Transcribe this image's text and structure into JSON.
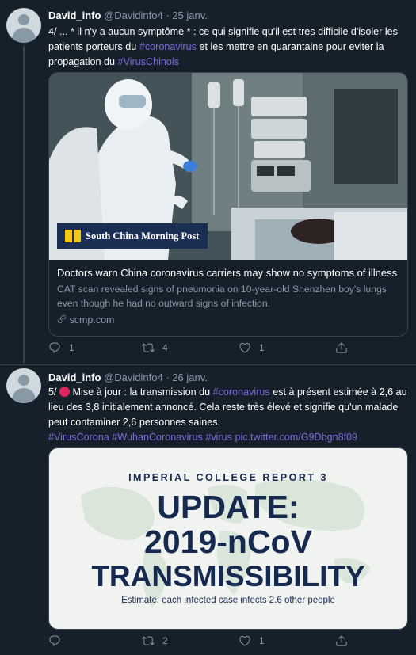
{
  "tweets": [
    {
      "author": "David_info",
      "handle": "@Davidinfo4",
      "date": "· 25 janv.",
      "text": {
        "t1": "4/ ... * il n'y a aucun symptôme * : ce qui signifie qu'il est tres difficile d'isoler les patients porteurs du ",
        "h1": "#coronavirus",
        "t2": " et les mettre en quarantaine pour eviter la propagation du ",
        "h2": "#VirusChinois"
      },
      "card": {
        "logo_text": "South China Morning Post",
        "title": "Doctors warn China coronavirus carriers may show no symptoms of illness",
        "description": "CAT scan revealed signs of pneumonia on 10-year-old Shenzhen boy's lungs even though he had no outward signs of infection.",
        "domain": "scmp.com"
      },
      "actions": {
        "replies": "1",
        "retweets": "4",
        "likes": "1"
      }
    },
    {
      "author": "David_info",
      "handle": "@Davidinfo4",
      "date": "· 26 janv.",
      "text": {
        "t1": "5/ ",
        "t2": " Mise à jour : la transmission du ",
        "h1": "#coronavirus",
        "t3": " est à présent estimée à 2,6 au lieu des 3,8 initialement annoncé. Cela reste très élevé et signifie qu'un malade peut  contaminer 2,6 personnes saines.",
        "h2": "#VirusCorona",
        "h3": "#WuhanCoronavirus",
        "h4": "#virus",
        "link": "pic.twitter.com/G9Dbgn8f09"
      },
      "image": {
        "kicker": "IMPERIAL COLLEGE REPORT 3",
        "line1": "UPDATE:",
        "line2": "2019-nCoV",
        "line3": "TRANSMISSIBILITY",
        "caption": "Estimate: each infected case infects 2.6 other people"
      },
      "actions": {
        "replies": "",
        "retweets": "2",
        "likes": "1"
      }
    }
  ],
  "colors": {
    "background": "#15202b",
    "hashtag": "#7e6bd8",
    "muted": "#8899a6",
    "border": "#38444d",
    "emoji_red": "#e0245e"
  }
}
